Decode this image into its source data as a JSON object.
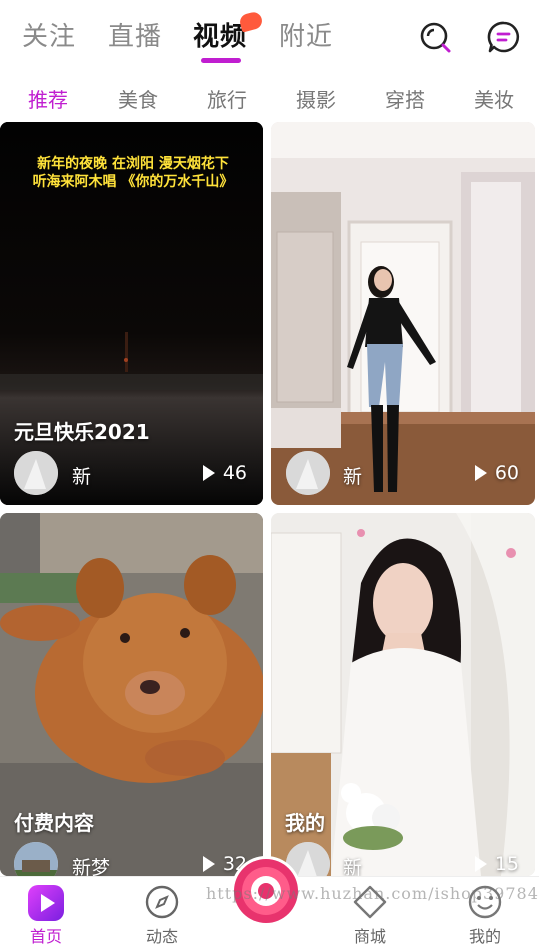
{
  "top_tabs": [
    {
      "label": "关注"
    },
    {
      "label": "直播"
    },
    {
      "label": "视频"
    },
    {
      "label": "附近"
    }
  ],
  "categories": [
    "推荐",
    "美食",
    "旅行",
    "摄影",
    "穿搭",
    "美妆"
  ],
  "cards": [
    {
      "overlay_text_line1": "新年的夜晚 在浏阳 漫天烟花下",
      "overlay_text_line2": "听海来阿木唱 《你的万水千山》",
      "title": "元旦快乐2021",
      "user": "新",
      "plays": "46"
    },
    {
      "title": "",
      "user": "新",
      "plays": "60"
    },
    {
      "title": "付费内容",
      "user": "新梦",
      "plays": "32"
    },
    {
      "title": "我的",
      "user": "新",
      "plays": "15"
    }
  ],
  "bottom_nav": [
    {
      "label": "首页"
    },
    {
      "label": "动态"
    },
    {
      "label": ""
    },
    {
      "label": "商城"
    },
    {
      "label": "我的"
    }
  ],
  "watermark": "https://www.huzhan.com/ishop39784",
  "colors": {
    "accent": "#c01ed0",
    "hot": "#ff5a3c"
  }
}
